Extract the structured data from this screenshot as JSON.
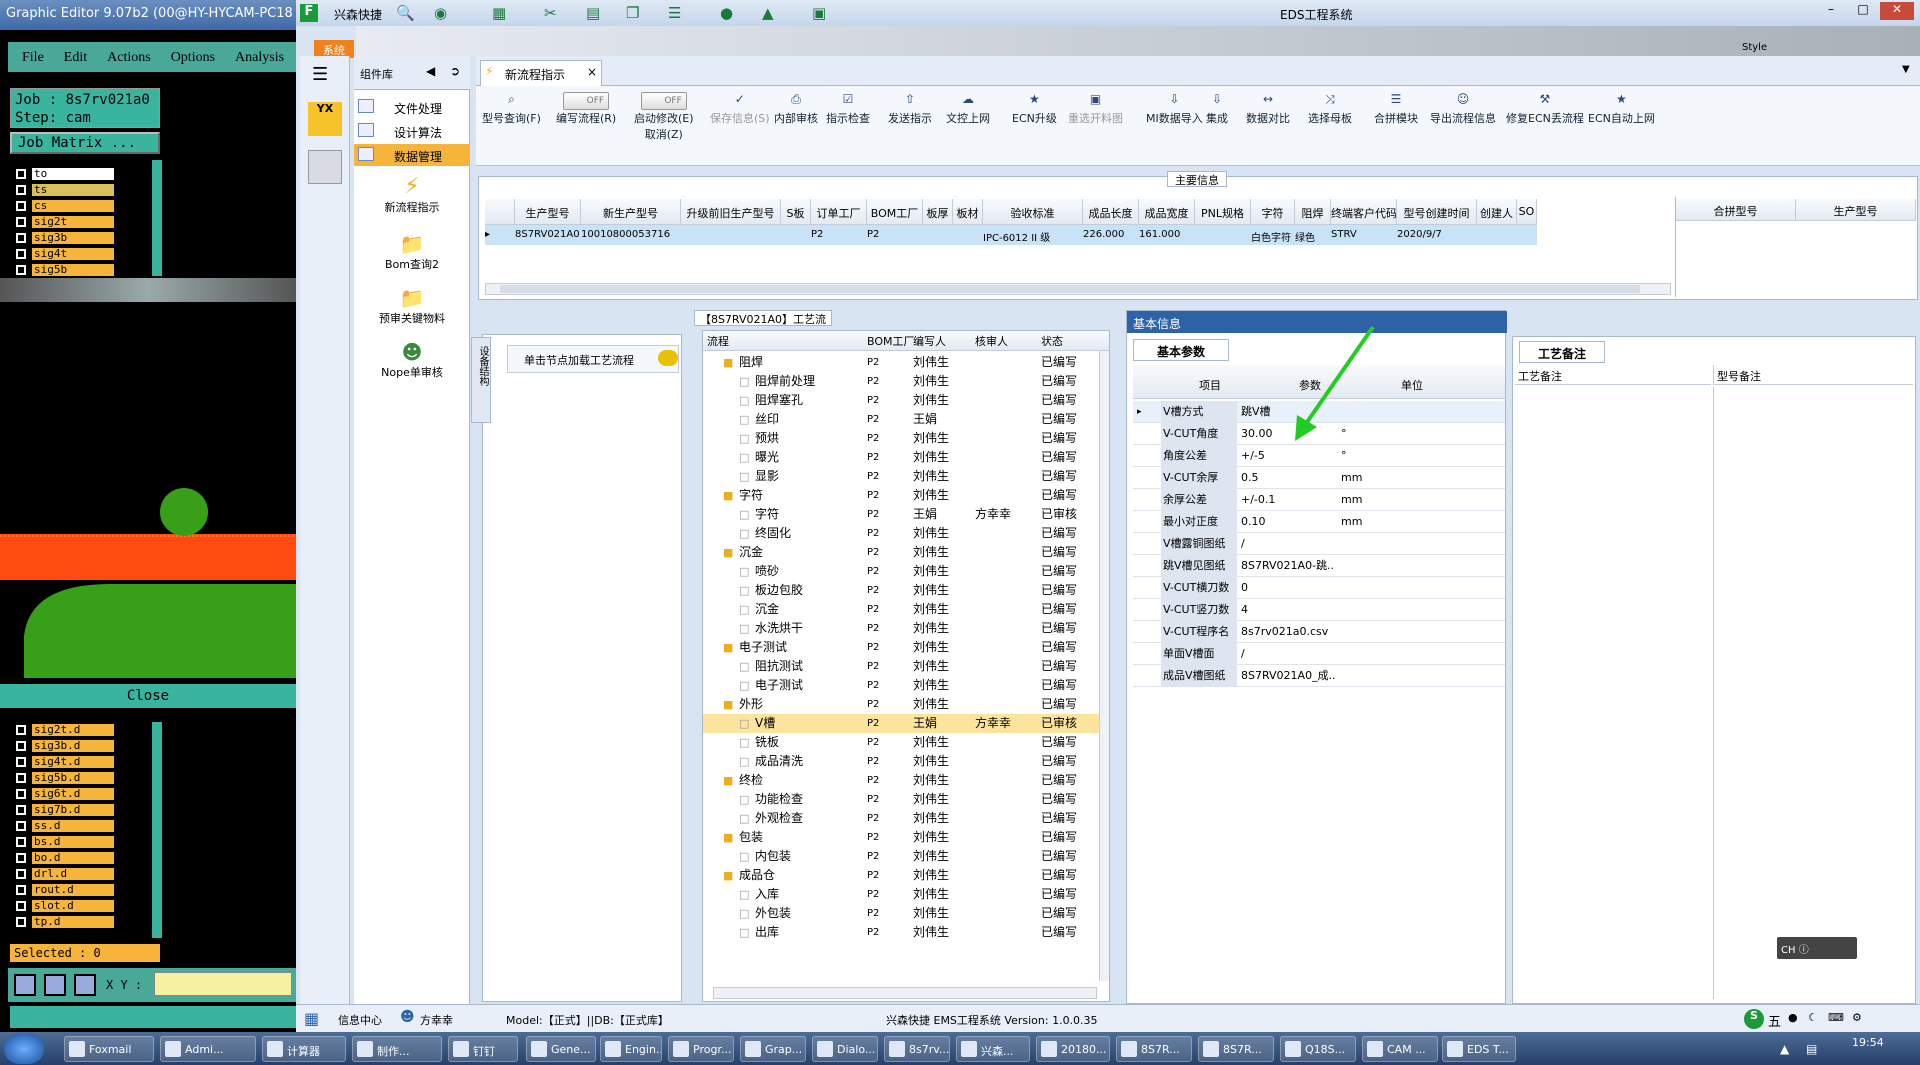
{
  "graphic_editor": {
    "title": "Graphic Editor 9.07b2 (00@HY-HYCAM-PC18",
    "menu": [
      "File",
      "Edit",
      "Actions",
      "Options",
      "Analysis"
    ],
    "job_line": "Job : 8s7rv021a0",
    "step_line": "Step: cam",
    "job_matrix": "Job Matrix ...",
    "layers_top": [
      "to",
      "ts",
      "cs",
      "sig2t",
      "sig3b",
      "sig4t",
      "sig5b"
    ],
    "close": "Close",
    "layers_bottom": [
      "sig2t.d",
      "sig3b.d",
      "sig4t.d",
      "sig5b.d",
      "sig6t.d",
      "sig7b.d",
      "ss.d",
      "bs.d",
      "bo.d",
      "drl.d",
      "rout.d",
      "slot.d",
      "tp.d"
    ],
    "selected": "Selected : 0",
    "xy_label": "X Y :"
  },
  "eds": {
    "window_title": "EDS工程系统",
    "quick_label": "兴森快捷",
    "system_tab": "系统",
    "style_label": "Style",
    "library": {
      "header": "组件库",
      "items": [
        "文件处理",
        "设计算法",
        "数据管理"
      ],
      "tools": [
        "新流程指示",
        "Bom查询2",
        "预审关键物料",
        "Nope单审核"
      ]
    },
    "doc_tab": "新流程指示",
    "toolbar": {
      "type_query": "型号查询(F)",
      "toggle_off": "OFF",
      "write_flow": "编写流程(R)",
      "auto_modify": "启动修改(E)",
      "cancel": "取消(Z)",
      "buttons": [
        "保存信息(S)",
        "内部审核",
        "指示检查",
        "发送指示",
        "文控上网",
        "ECN升级",
        "重选开料图",
        "MI数据导入",
        "集成",
        "数据对比",
        "选择母板",
        "合拼模块",
        "导出流程信息",
        "修复ECN丢流程",
        "ECN自动上网"
      ]
    },
    "main_info": {
      "title": "主要信息",
      "columns": [
        "生产型号",
        "新生产型号",
        "升级前旧生产型号",
        "S板",
        "订单工厂",
        "BOM工厂",
        "板厚",
        "板材",
        "验收标准",
        "成品长度",
        "成品宽度",
        "PNL规格",
        "字符",
        "阻焊",
        "终端客户代码",
        "型号创建时间",
        "创建人",
        "SO"
      ],
      "row": [
        "8S7RV021A0",
        "10010800053716",
        "",
        "",
        "P2",
        "P2",
        "",
        "",
        "IPC-6012 II 级",
        "226.000",
        "161.000",
        "",
        "白色字符",
        "绿色",
        "STRV",
        "2020/9/7",
        "",
        ""
      ],
      "side_columns": [
        "合拼型号",
        "生产型号"
      ]
    },
    "flow": {
      "title": "【8S7RV021A0】工艺流程",
      "side_tab": "设备结构",
      "click_hint": "单击节点加载工艺流程",
      "columns": [
        "流程",
        "BOM工厂",
        "编写人",
        "核审人",
        "状态"
      ],
      "rows": [
        {
          "level": 1,
          "name": "阻焊",
          "factory": "P2",
          "writer": "刘伟生",
          "reviewer": "",
          "status": "已编写"
        },
        {
          "level": 2,
          "name": "阻焊前处理",
          "factory": "P2",
          "writer": "刘伟生",
          "reviewer": "",
          "status": "已编写"
        },
        {
          "level": 2,
          "name": "阻焊塞孔",
          "factory": "P2",
          "writer": "刘伟生",
          "reviewer": "",
          "status": "已编写"
        },
        {
          "level": 2,
          "name": "丝印",
          "factory": "P2",
          "writer": "王娟",
          "reviewer": "",
          "status": "已编写"
        },
        {
          "level": 2,
          "name": "预烘",
          "factory": "P2",
          "writer": "刘伟生",
          "reviewer": "",
          "status": "已编写"
        },
        {
          "level": 2,
          "name": "曝光",
          "factory": "P2",
          "writer": "刘伟生",
          "reviewer": "",
          "status": "已编写"
        },
        {
          "level": 2,
          "name": "显影",
          "factory": "P2",
          "writer": "刘伟生",
          "reviewer": "",
          "status": "已编写"
        },
        {
          "level": 1,
          "name": "字符",
          "factory": "P2",
          "writer": "刘伟生",
          "reviewer": "",
          "status": "已编写"
        },
        {
          "level": 2,
          "name": "字符",
          "factory": "P2",
          "writer": "王娟",
          "reviewer": "方幸幸",
          "status": "已审核"
        },
        {
          "level": 2,
          "name": "终固化",
          "factory": "P2",
          "writer": "刘伟生",
          "reviewer": "",
          "status": "已编写"
        },
        {
          "level": 1,
          "name": "沉金",
          "factory": "P2",
          "writer": "刘伟生",
          "reviewer": "",
          "status": "已编写"
        },
        {
          "level": 2,
          "name": "喷砂",
          "factory": "P2",
          "writer": "刘伟生",
          "reviewer": "",
          "status": "已编写"
        },
        {
          "level": 2,
          "name": "板边包胶",
          "factory": "P2",
          "writer": "刘伟生",
          "reviewer": "",
          "status": "已编写"
        },
        {
          "level": 2,
          "name": "沉金",
          "factory": "P2",
          "writer": "刘伟生",
          "reviewer": "",
          "status": "已编写"
        },
        {
          "level": 2,
          "name": "水洗烘干",
          "factory": "P2",
          "writer": "刘伟生",
          "reviewer": "",
          "status": "已编写"
        },
        {
          "level": 1,
          "name": "电子测试",
          "factory": "P2",
          "writer": "刘伟生",
          "reviewer": "",
          "status": "已编写"
        },
        {
          "level": 2,
          "name": "阻抗测试",
          "factory": "P2",
          "writer": "刘伟生",
          "reviewer": "",
          "status": "已编写"
        },
        {
          "level": 2,
          "name": "电子测试",
          "factory": "P2",
          "writer": "刘伟生",
          "reviewer": "",
          "status": "已编写"
        },
        {
          "level": 1,
          "name": "外形",
          "factory": "P2",
          "writer": "刘伟生",
          "reviewer": "",
          "status": "已编写"
        },
        {
          "level": 2,
          "name": "V槽",
          "factory": "P2",
          "writer": "王娟",
          "reviewer": "方幸幸",
          "status": "已审核",
          "selected": true
        },
        {
          "level": 2,
          "name": "铣板",
          "factory": "P2",
          "writer": "刘伟生",
          "reviewer": "",
          "status": "已编写"
        },
        {
          "level": 2,
          "name": "成品清洗",
          "factory": "P2",
          "writer": "刘伟生",
          "reviewer": "",
          "status": "已编写"
        },
        {
          "level": 1,
          "name": "终检",
          "factory": "P2",
          "writer": "刘伟生",
          "reviewer": "",
          "status": "已编写"
        },
        {
          "level": 2,
          "name": "功能检查",
          "factory": "P2",
          "writer": "刘伟生",
          "reviewer": "",
          "status": "已编写"
        },
        {
          "level": 2,
          "name": "外观检查",
          "factory": "P2",
          "writer": "刘伟生",
          "reviewer": "",
          "status": "已编写"
        },
        {
          "level": 1,
          "name": "包装",
          "factory": "P2",
          "writer": "刘伟生",
          "reviewer": "",
          "status": "已编写"
        },
        {
          "level": 2,
          "name": "内包装",
          "factory": "P2",
          "writer": "刘伟生",
          "reviewer": "",
          "status": "已编写"
        },
        {
          "level": 1,
          "name": "成品仓",
          "factory": "P2",
          "writer": "刘伟生",
          "reviewer": "",
          "status": "已编写"
        },
        {
          "level": 2,
          "name": "入库",
          "factory": "P2",
          "writer": "刘伟生",
          "reviewer": "",
          "status": "已编写"
        },
        {
          "level": 2,
          "name": "外包装",
          "factory": "P2",
          "writer": "刘伟生",
          "reviewer": "",
          "status": "已编写"
        },
        {
          "level": 2,
          "name": "出库",
          "factory": "P2",
          "writer": "刘伟生",
          "reviewer": "",
          "status": "已编写"
        }
      ]
    },
    "basic_info": {
      "title": "基本信息",
      "subtab": "基本参数",
      "columns": [
        "项目",
        "参数",
        "单位"
      ],
      "rows": [
        {
          "item": "V槽方式",
          "param": "跳V槽",
          "unit": ""
        },
        {
          "item": "V-CUT角度",
          "param": "30.00",
          "unit": "°"
        },
        {
          "item": "角度公差",
          "param": "+/-5",
          "unit": "°"
        },
        {
          "item": "V-CUT余厚",
          "param": "0.5",
          "unit": "mm"
        },
        {
          "item": "余厚公差",
          "param": "+/-0.1",
          "unit": "mm"
        },
        {
          "item": "最小对正度",
          "param": "0.10",
          "unit": "mm"
        },
        {
          "item": "V槽露铜图纸",
          "param": "/",
          "unit": ""
        },
        {
          "item": "跳V槽见图纸",
          "param": "8S7RV021A0-跳...",
          "unit": ""
        },
        {
          "item": "V-CUT横刀数",
          "param": "0",
          "unit": ""
        },
        {
          "item": "V-CUT竖刀数",
          "param": "4",
          "unit": ""
        },
        {
          "item": "V-CUT程序名",
          "param": "8s7rv021a0.csv",
          "unit": ""
        },
        {
          "item": "单面V槽面",
          "param": "/",
          "unit": ""
        },
        {
          "item": "成品V槽图纸",
          "param": "8S7RV021A0_成...",
          "unit": ""
        }
      ]
    },
    "process_notes": {
      "title": "工艺备注",
      "col1": "工艺备注",
      "col2": "型号备注"
    },
    "status": {
      "info_center": "信息中心",
      "user": "方幸幸",
      "model": "Model:【正式】||DB:【正式库】",
      "version": "兴森快捷 EMS工程系统 Version: 1.0.0.35"
    },
    "ime": "CH"
  },
  "taskbar": {
    "items": [
      "Foxmail",
      "Admi...",
      "计算器",
      "制作...",
      "钉钉",
      "Gene...",
      "Engin...",
      "Progr...",
      "Grap...",
      "Dialo...",
      "8s7rv...",
      "兴森...",
      "20180...",
      "8S7R...",
      "8S7R...",
      "Q18S...",
      "CAM ...",
      "EDS T..."
    ],
    "clock": "19:54",
    "ime": "五"
  },
  "colors": {
    "accent": "#f0811c",
    "selected_row": "#fde49c",
    "arrow": "#22cc22",
    "panel_header": "#2f63a8"
  }
}
